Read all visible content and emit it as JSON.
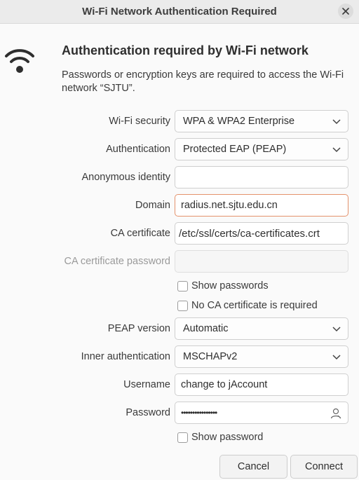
{
  "window": {
    "title": "Wi-Fi Network Authentication Required"
  },
  "icons": {
    "network": "wifi-icon",
    "close": "close-icon",
    "chevron": "chevron-down-icon",
    "user": "user-icon"
  },
  "heading": "Authentication required by Wi-Fi network",
  "description": "Passwords or encryption keys are required to access the Wi-Fi network “SJTU”.",
  "form": {
    "wifi_security": {
      "label": "Wi-Fi security",
      "value": "WPA & WPA2 Enterprise"
    },
    "authentication": {
      "label": "Authentication",
      "value": "Protected EAP (PEAP)"
    },
    "anonymous_identity": {
      "label": "Anonymous identity",
      "value": ""
    },
    "domain": {
      "label": "Domain",
      "value": "radius.net.sjtu.edu.cn"
    },
    "ca_certificate": {
      "label": "CA certificate",
      "value": "/etc/ssl/certs/ca-certificates.crt"
    },
    "ca_certificate_password": {
      "label": "CA certificate password",
      "value": ""
    },
    "show_passwords": {
      "label": "Show passwords"
    },
    "no_ca_required": {
      "label": "No CA certificate is required"
    },
    "peap_version": {
      "label": "PEAP version",
      "value": "Automatic"
    },
    "inner_auth": {
      "label": "Inner authentication",
      "value": "MSCHAPv2"
    },
    "username": {
      "label": "Username",
      "value": "change to jAccount"
    },
    "password": {
      "label": "Password",
      "value": "••••••••••••••••"
    },
    "show_password": {
      "label": "Show password"
    }
  },
  "buttons": {
    "cancel": "Cancel",
    "connect": "Connect"
  },
  "colors": {
    "focus_border": "#e4926c",
    "titlebar": "#ebebeb"
  }
}
